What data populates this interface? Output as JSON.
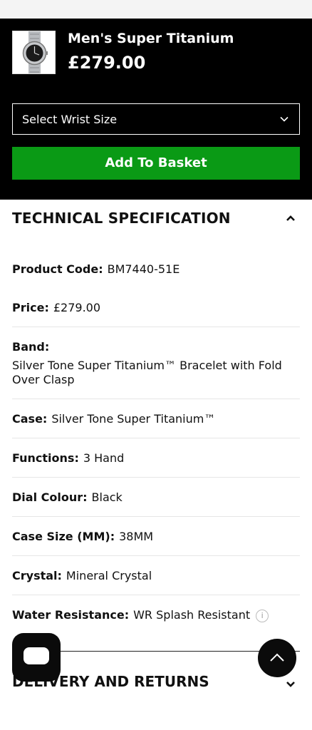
{
  "product": {
    "name": "Men's Super Titanium",
    "price": "£279.00"
  },
  "controls": {
    "size_select_label": "Select Wrist Size",
    "add_button_label": "Add To Basket"
  },
  "spec_section": {
    "title": "TECHNICAL SPECIFICATION",
    "rows": [
      {
        "key": "Product Code:",
        "value": "BM7440-51E"
      },
      {
        "key": "Price:",
        "value": "£279.00"
      },
      {
        "key": "Band:",
        "value": "Silver Tone Super Titanium™ Bracelet with Fold Over Clasp"
      },
      {
        "key": "Case:",
        "value": "Silver Tone Super Titanium™"
      },
      {
        "key": "Functions:",
        "value": "3 Hand"
      },
      {
        "key": "Dial Colour:",
        "value": "Black"
      },
      {
        "key": "Case Size (MM):",
        "value": "38MM"
      },
      {
        "key": "Crystal:",
        "value": "Mineral Crystal"
      },
      {
        "key": "Water Resistance:",
        "value": "WR Splash Resistant"
      }
    ]
  },
  "delivery_section": {
    "title": "DELIVERY AND RETURNS"
  },
  "colors": {
    "accent_green": "#0a9a15",
    "bar_black": "#000000"
  },
  "icons": {
    "select": "chevron-down-icon",
    "spec_toggle": "chevron-up-icon",
    "info": "info-icon",
    "chat": "chat-icon",
    "back_to_top": "arrow-up-icon"
  }
}
